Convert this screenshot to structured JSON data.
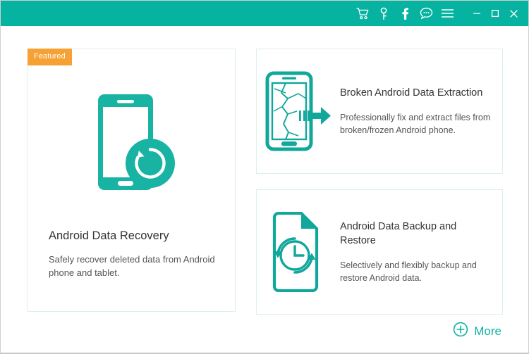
{
  "window": {
    "accent_color": "#06b2a0",
    "badge_color": "#f5a133",
    "card_border_color": "#dcefeb",
    "title_text_color": "#333333",
    "desc_text_color": "#555555"
  },
  "title_bar": {
    "icons": [
      {
        "name": "cart-icon",
        "label": "Shopping Cart"
      },
      {
        "name": "key-icon",
        "label": "Register Key"
      },
      {
        "name": "facebook-icon",
        "label": "Facebook"
      },
      {
        "name": "chat-icon",
        "label": "Support Chat"
      },
      {
        "name": "menu-icon",
        "label": "Menu"
      }
    ],
    "window_controls": [
      {
        "name": "minimize-button",
        "label": "Minimize",
        "glyph": "–"
      },
      {
        "name": "maximize-button",
        "label": "Maximize",
        "glyph": "□"
      },
      {
        "name": "close-button",
        "label": "Close",
        "glyph": "×"
      }
    ]
  },
  "cards": {
    "recovery": {
      "badge": "Featured",
      "icon": "phone-restore-icon",
      "title": "Android Data Recovery",
      "description": "Safely recover deleted data from Android phone and tablet."
    },
    "broken": {
      "icon": "broken-phone-extract-icon",
      "title": "Broken Android Data Extraction",
      "description": "Professionally fix and extract files from broken/frozen Android phone."
    },
    "backup": {
      "icon": "document-clock-restore-icon",
      "title": "Android Data Backup and Restore",
      "description": "Selectively and flexibly backup and restore Android data."
    }
  },
  "more": {
    "icon": "plus-circle-icon",
    "label": "More"
  }
}
